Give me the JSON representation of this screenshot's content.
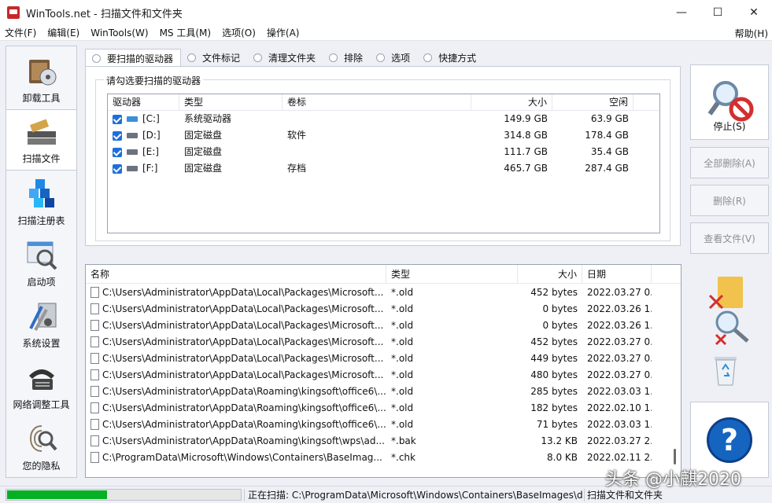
{
  "window": {
    "title": "WinTools.net - 扫描文件和文件夹",
    "minimize": "—",
    "maximize": "☐",
    "close": "✕"
  },
  "menu": {
    "items": [
      "文件(F)",
      "编辑(E)",
      "WinTools(W)",
      "MS 工具(M)",
      "选项(O)",
      "操作(A)"
    ],
    "help": "帮助(H)"
  },
  "sidebar": {
    "items": [
      {
        "label": "卸载工具",
        "icon": "uninstall-icon"
      },
      {
        "label": "扫描文件",
        "icon": "scan-files-icon",
        "active": true
      },
      {
        "label": "扫描注册表",
        "icon": "registry-icon"
      },
      {
        "label": "启动项",
        "icon": "startup-icon"
      },
      {
        "label": "系统设置",
        "icon": "settings-icon"
      },
      {
        "label": "网络调整工具",
        "icon": "network-icon"
      },
      {
        "label": "您的隐私",
        "icon": "privacy-icon"
      }
    ]
  },
  "tabs": [
    "要扫描的驱动器",
    "文件标记",
    "清理文件夹",
    "排除",
    "选项",
    "快捷方式"
  ],
  "drives_group": {
    "title": "请勾选要扫描的驱动器",
    "headers": {
      "drive": "驱动器",
      "type": "类型",
      "label": "卷标",
      "size": "大小",
      "free": "空闲"
    },
    "rows": [
      {
        "drive": "[C:]",
        "type": "系统驱动器",
        "label": "",
        "size": "149.9 GB",
        "free": "63.9 GB",
        "checked": true,
        "system": true
      },
      {
        "drive": "[D:]",
        "type": "固定磁盘",
        "label": "软件",
        "size": "314.8 GB",
        "free": "178.4 GB",
        "checked": true,
        "system": false
      },
      {
        "drive": "[E:]",
        "type": "固定磁盘",
        "label": "",
        "size": "111.7 GB",
        "free": "35.4 GB",
        "checked": true,
        "system": false
      },
      {
        "drive": "[F:]",
        "type": "固定磁盘",
        "label": "存档",
        "size": "465.7 GB",
        "free": "287.4 GB",
        "checked": true,
        "system": false
      }
    ]
  },
  "file_list": {
    "headers": {
      "name": "名称",
      "type": "类型",
      "size": "大小",
      "date": "日期"
    },
    "rows": [
      {
        "name": "C:\\Users\\Administrator\\AppData\\Local\\Packages\\Microsoft...",
        "type": "*.old",
        "size": "452 bytes",
        "date": "2022.03.27 0..."
      },
      {
        "name": "C:\\Users\\Administrator\\AppData\\Local\\Packages\\Microsoft...",
        "type": "*.old",
        "size": "0 bytes",
        "date": "2022.03.26 1..."
      },
      {
        "name": "C:\\Users\\Administrator\\AppData\\Local\\Packages\\Microsoft...",
        "type": "*.old",
        "size": "0 bytes",
        "date": "2022.03.26 1..."
      },
      {
        "name": "C:\\Users\\Administrator\\AppData\\Local\\Packages\\Microsoft...",
        "type": "*.old",
        "size": "452 bytes",
        "date": "2022.03.27 0..."
      },
      {
        "name": "C:\\Users\\Administrator\\AppData\\Local\\Packages\\Microsoft...",
        "type": "*.old",
        "size": "449 bytes",
        "date": "2022.03.27 0..."
      },
      {
        "name": "C:\\Users\\Administrator\\AppData\\Local\\Packages\\Microsoft...",
        "type": "*.old",
        "size": "480 bytes",
        "date": "2022.03.27 0..."
      },
      {
        "name": "C:\\Users\\Administrator\\AppData\\Roaming\\kingsoft\\office6\\...",
        "type": "*.old",
        "size": "285 bytes",
        "date": "2022.03.03 1..."
      },
      {
        "name": "C:\\Users\\Administrator\\AppData\\Roaming\\kingsoft\\office6\\...",
        "type": "*.old",
        "size": "182 bytes",
        "date": "2022.02.10 1..."
      },
      {
        "name": "C:\\Users\\Administrator\\AppData\\Roaming\\kingsoft\\office6\\...",
        "type": "*.old",
        "size": "71 bytes",
        "date": "2022.03.03 1..."
      },
      {
        "name": "C:\\Users\\Administrator\\AppData\\Roaming\\kingsoft\\wps\\ad...",
        "type": "*.bak",
        "size": "13.2 KB",
        "date": "2022.03.27 2..."
      },
      {
        "name": "C:\\ProgramData\\Microsoft\\Windows\\Containers\\BaseImag...",
        "type": "*.chk",
        "size": "8.0 KB",
        "date": "2022.02.11 2..."
      }
    ]
  },
  "actions": {
    "stop": "停止(S)",
    "delete_all": "全部删除(A)",
    "delete": "删除(R)",
    "view_file": "查看文件(V)",
    "help_symbol": "?"
  },
  "status": {
    "progress": 0.43,
    "scanning_text": "正在扫描: C:\\ProgramData\\Microsoft\\Windows\\Containers\\BaseImages\\d",
    "right_text": "扫描文件和文件夹"
  },
  "watermark": "头条 @小麒2020",
  "colors": {
    "accent": "#1e6fd9",
    "progress": "#06b025",
    "stop_red": "#d32f2f",
    "help_blue": "#1565c0"
  }
}
